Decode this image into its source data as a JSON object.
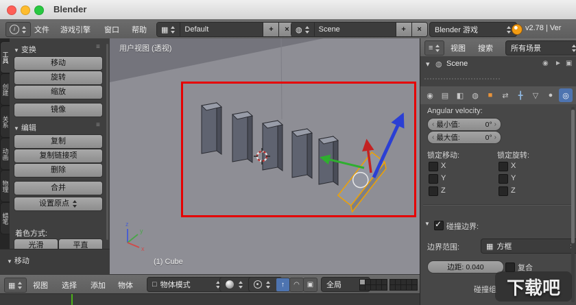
{
  "window": {
    "title": "Blender"
  },
  "topbar": {
    "menus": [
      "文件",
      "游戏引擎",
      "窗口",
      "帮助"
    ],
    "layout": {
      "value": "Default"
    },
    "scene": {
      "value": "Scene"
    },
    "engine": {
      "value": "Blender 游戏"
    },
    "version": "v2.78 | Ver"
  },
  "left_tabs": [
    "工具",
    "创建",
    "关系",
    "动画",
    "物理",
    "蜡笔"
  ],
  "toolshelf": {
    "transform": {
      "header": "变换",
      "buttons": [
        "移动",
        "旋转",
        "缩放"
      ],
      "mirror": "镜像"
    },
    "edit": {
      "header": "编辑",
      "buttons": [
        "复制",
        "复制链接项",
        "删除"
      ],
      "join": "合并",
      "set_origin": "设置原点"
    },
    "shading": {
      "label": "着色方式:",
      "smooth": "光滑",
      "flat": "平直"
    },
    "redo": {
      "header": "移动"
    }
  },
  "viewport": {
    "view_label": "用户视图 (透视)",
    "object_info": "(1) Cube",
    "axis": {
      "x": "x",
      "y": "y",
      "z": "z"
    }
  },
  "view3d_header": {
    "menus": [
      "视图",
      "选择",
      "添加",
      "物体"
    ],
    "mode": "物体模式",
    "orientation": "全局"
  },
  "outliner": {
    "menus": [
      "视图",
      "搜索"
    ],
    "display_filter": "所有场景",
    "scene": "Scene"
  },
  "properties": {
    "angular_velocity_label": "Angular velocity:",
    "min": {
      "label": "最小值:",
      "value": "0°"
    },
    "max": {
      "label": "最大值:",
      "value": "0°"
    },
    "lock_translation_label": "锁定移动:",
    "lock_rotation_label": "锁定旋转:",
    "axes": [
      "X",
      "Y",
      "Z"
    ],
    "collision": {
      "header": "碰撞边界:",
      "bounds_label": "边界范围:",
      "bounds_value": "方框",
      "margin_label": "边距:",
      "margin_value": "0.040",
      "compound_label": "复合",
      "group_label": "碰撞组"
    }
  },
  "watermark": "下载吧",
  "icons": {
    "add": "+",
    "close": "×",
    "check": "✓",
    "panel_collapse": "▼",
    "disclosure": "▾",
    "menu_lines": "≡",
    "grid": "▦",
    "screen": "▦",
    "scene_ball": "◍",
    "info": "i",
    "mode_cube": "□",
    "translate_manip": "↑",
    "rotate_manip": "◠",
    "scale_manip": "▣",
    "render_tab": "◉",
    "layers_tab": "▤",
    "scene_tab": "◧",
    "world_tab": "◍",
    "object_tab": "■",
    "constraints_tab": "⇄",
    "modifiers_tab": "╋",
    "data_tab": "▽",
    "material_tab": "●",
    "physics_tab": "◎",
    "eye": "◉",
    "select_arrow": "►",
    "camera_restrict": "▣",
    "box_bounds": "▦",
    "left_arrow": "‹",
    "right_arrow": "›"
  },
  "colors": {
    "annotation_red": "#e60000",
    "selection_orange": "#f0a200",
    "active_tab_blue": "#4e74b0",
    "playhead_green": "#4db21a",
    "axis_x": "#d04a4a",
    "axis_y": "#4aa54a",
    "axis_z": "#4a5fd0"
  }
}
